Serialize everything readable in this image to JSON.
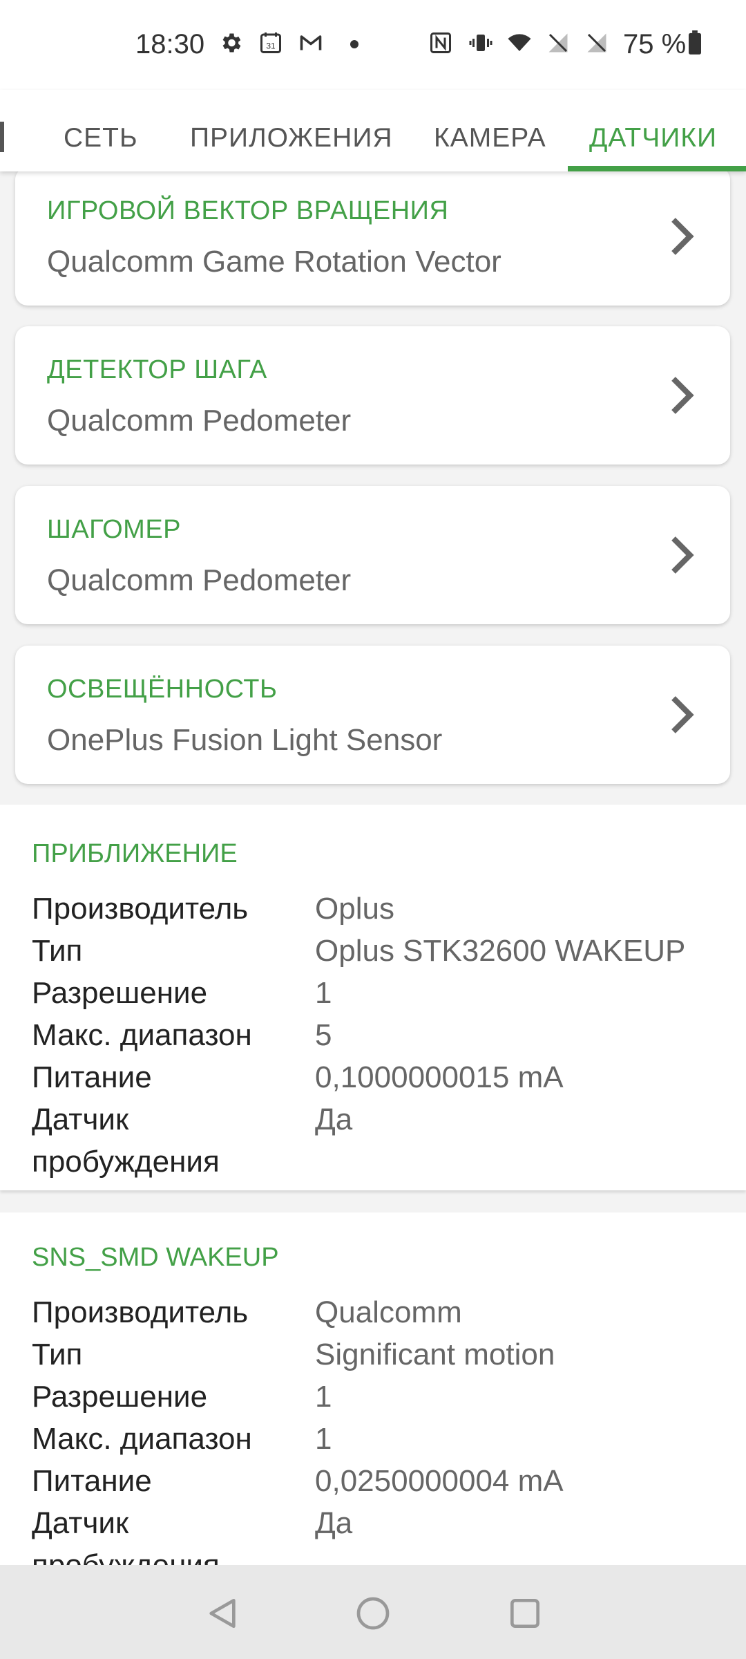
{
  "status_bar": {
    "time": "18:30",
    "battery_text": "75 %",
    "icons": [
      "gear-icon",
      "calendar-icon",
      "gmail-icon",
      "dot-icon",
      "nfc-icon",
      "vibrate-icon",
      "wifi-icon",
      "no-signal-icon",
      "no-signal-icon",
      "battery-icon"
    ],
    "calendar_day": "31"
  },
  "tabs": [
    {
      "label": "СЕТЬ"
    },
    {
      "label": "ПРИЛОЖЕНИЯ"
    },
    {
      "label": "КАМЕРА"
    },
    {
      "label": "ДАТЧИКИ",
      "active": true
    }
  ],
  "cards": [
    {
      "title": "ИГРОВОЙ ВЕКТОР ВРАЩЕНИЯ",
      "subtitle": "Qualcomm Game Rotation Vector"
    },
    {
      "title": "ДЕТЕКТОР ШАГА",
      "subtitle": "Qualcomm Pedometer"
    },
    {
      "title": "ШАГОМЕР",
      "subtitle": "Qualcomm Pedometer"
    },
    {
      "title": "ОСВЕЩЁННОСТЬ",
      "subtitle": "OnePlus Fusion Light Sensor"
    }
  ],
  "panels": [
    {
      "title": "ПРИБЛИЖЕНИЕ",
      "rows": [
        {
          "key": "Производитель",
          "value": "Oplus"
        },
        {
          "key": "Тип",
          "value": "Oplus STK32600  WAKEUP"
        },
        {
          "key": "Разрешение",
          "value": "1"
        },
        {
          "key": "Макс. диапазон",
          "value": "5"
        },
        {
          "key": "Питание",
          "value": "0,1000000015 mA"
        },
        {
          "key": "Датчик пробуждения",
          "value": "Да"
        }
      ]
    },
    {
      "title": "SNS_SMD  WAKEUP",
      "rows": [
        {
          "key": "Производитель",
          "value": "Qualcomm"
        },
        {
          "key": "Тип",
          "value": "Significant motion"
        },
        {
          "key": "Разрешение",
          "value": "1"
        },
        {
          "key": "Макс. диапазон",
          "value": "1"
        },
        {
          "key": "Питание",
          "value": "0,0250000004 mA"
        },
        {
          "key": "Датчик пробуждения",
          "value": "Да"
        }
      ]
    }
  ],
  "colors": {
    "accent": "#43a047",
    "background": "#f3f3f3"
  }
}
